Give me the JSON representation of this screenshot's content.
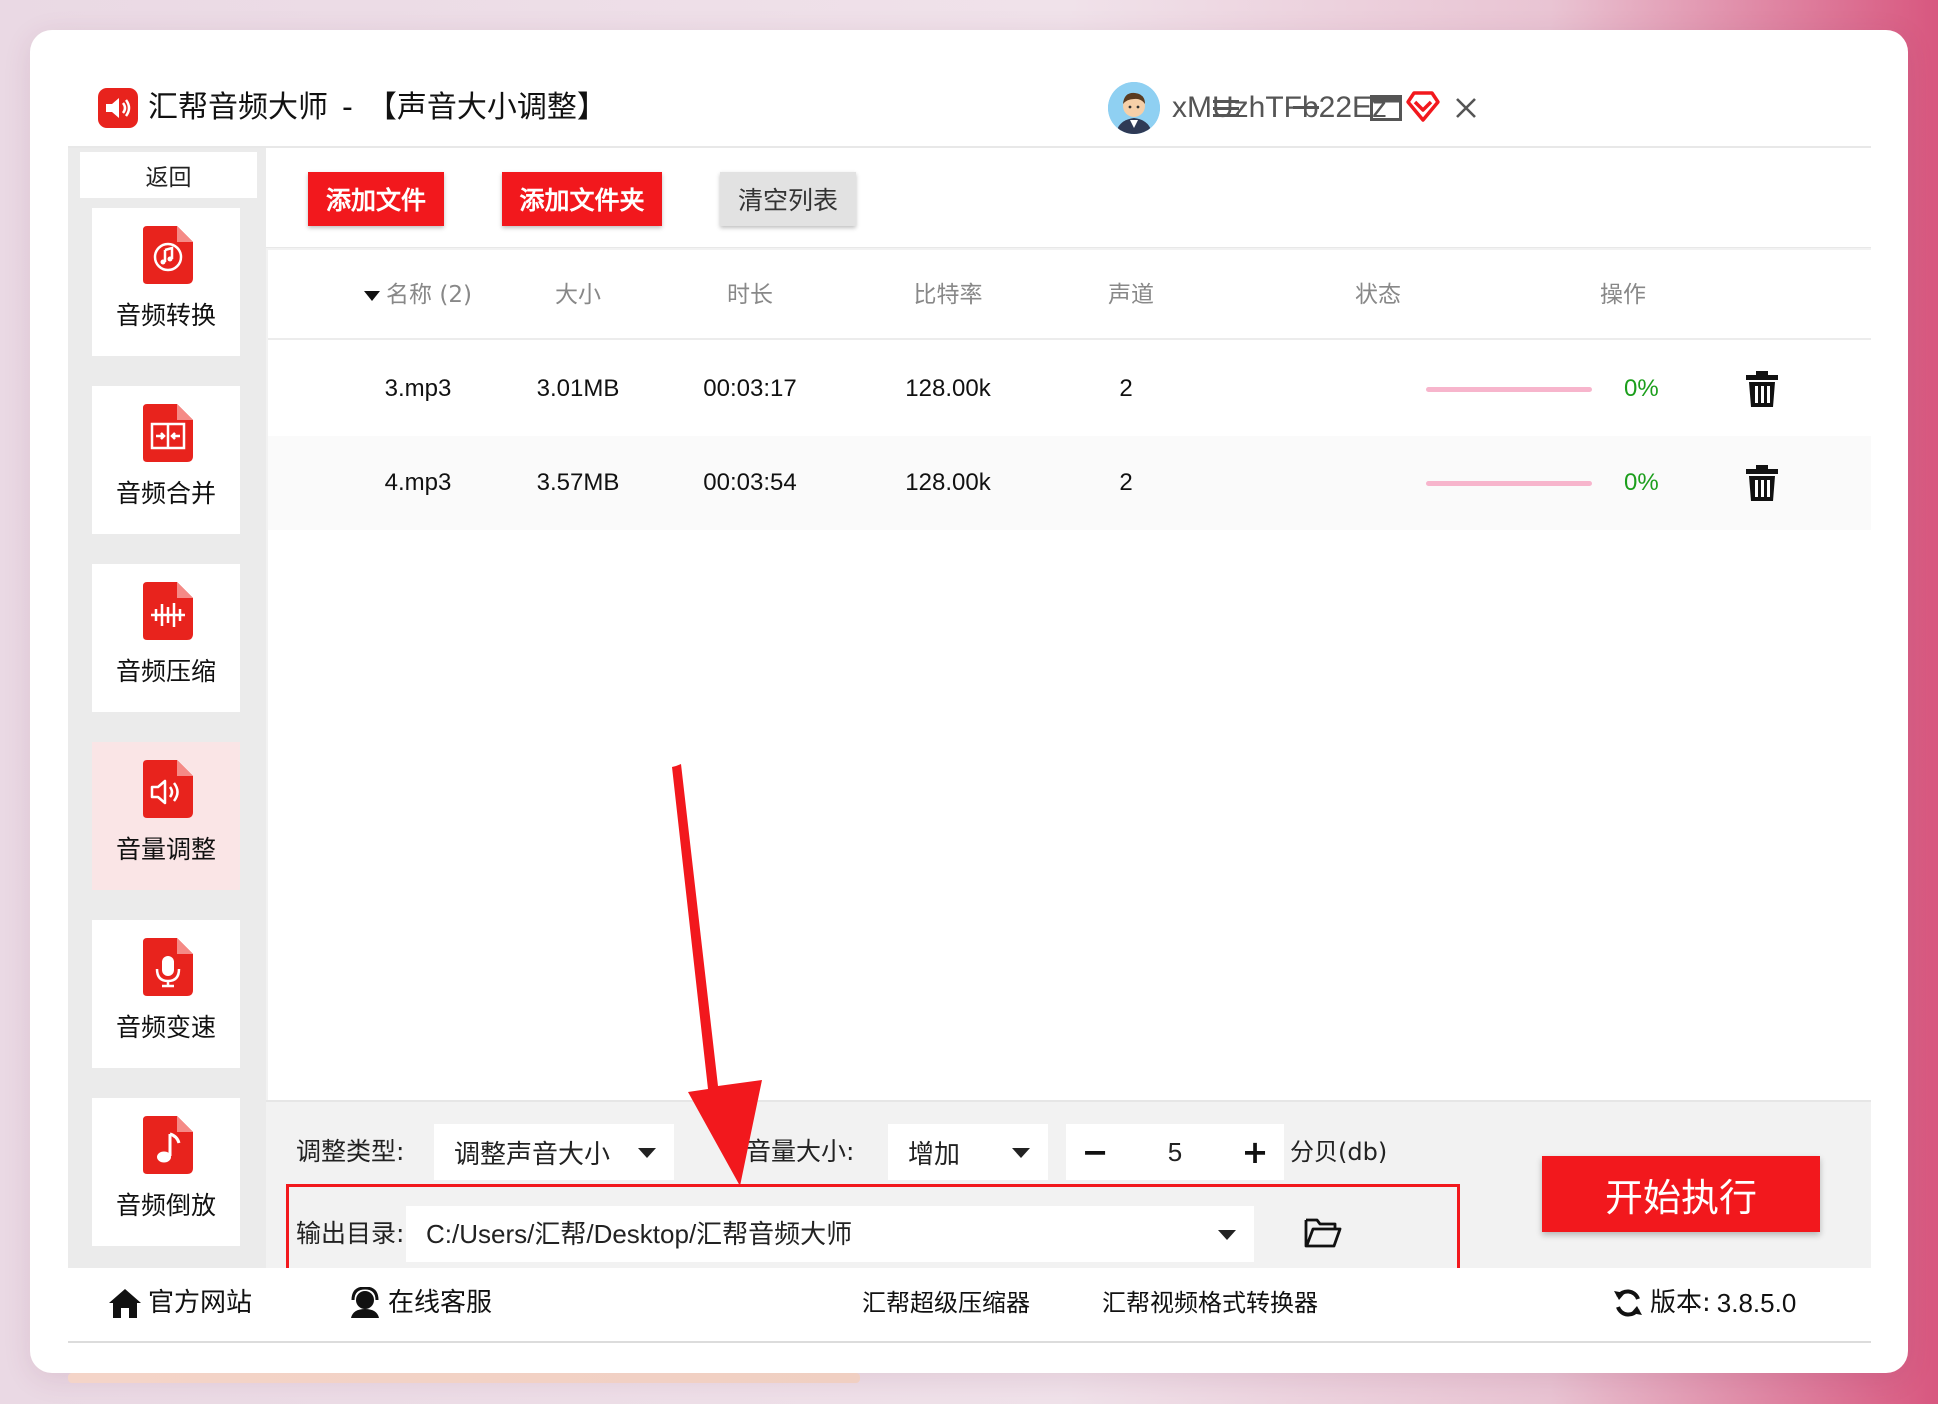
{
  "app": {
    "title": "汇帮音频大师",
    "separator": "-",
    "module": "【声音大小调整】",
    "username": "xMUzhTFb22Ez"
  },
  "colors": {
    "accent": "#f2181d",
    "success": "#1b9e1b",
    "progress": "#f7b5cc",
    "active_sidebar_bg": "#fae5e6"
  },
  "sidebar": {
    "back_label": "返回",
    "items": [
      {
        "label": "音频转换",
        "icon": "audio-convert-icon"
      },
      {
        "label": "音频合并",
        "icon": "audio-merge-icon"
      },
      {
        "label": "音频压缩",
        "icon": "audio-compress-icon"
      },
      {
        "label": "音量调整",
        "icon": "volume-icon",
        "active": true
      },
      {
        "label": "音频变速",
        "icon": "microphone-icon"
      },
      {
        "label": "音频倒放",
        "icon": "music-note-icon"
      }
    ]
  },
  "toolbar": {
    "add_file": "添加文件",
    "add_folder": "添加文件夹",
    "clear_list": "清空列表"
  },
  "table": {
    "headers": {
      "name": "名称 (2)",
      "size": "大小",
      "duration": "时长",
      "bitrate": "比特率",
      "channels": "声道",
      "status": "状态",
      "action": "操作"
    },
    "rows": [
      {
        "name": "3.mp3",
        "size": "3.01MB",
        "duration": "00:03:17",
        "bitrate": "128.00k",
        "channels": "2",
        "progress": 0,
        "progress_text": "0%"
      },
      {
        "name": "4.mp3",
        "size": "3.57MB",
        "duration": "00:03:54",
        "bitrate": "128.00k",
        "channels": "2",
        "progress": 0,
        "progress_text": "0%"
      }
    ]
  },
  "settings": {
    "adjust_type_label": "调整类型:",
    "adjust_type_value": "调整声音大小",
    "volume_label": "音量大小:",
    "volume_mode": "增加",
    "minus": "−",
    "plus": "+",
    "volume_value": "5",
    "unit": "分贝(db)",
    "output_label": "输出目录:",
    "output_path": "C:/Users/汇帮/Desktop/汇帮音频大师",
    "start_button": "开始执行"
  },
  "footer": {
    "website": "官方网站",
    "support": "在线客服",
    "compressor": "汇帮超级压缩器",
    "video_converter": "汇帮视频格式转换器",
    "version_label": "版本:",
    "version": "3.8.5.0"
  }
}
